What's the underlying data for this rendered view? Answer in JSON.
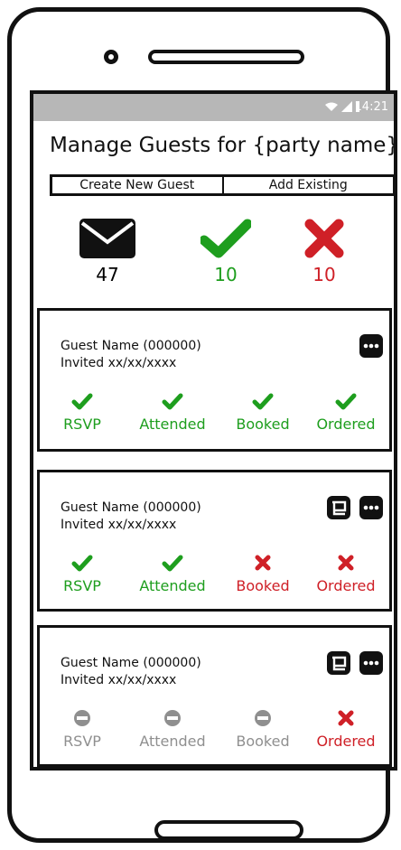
{
  "status_bar": {
    "time": "14:21"
  },
  "header": {
    "title": "Manage Guests for {party name}",
    "create_label": "Create New Guest",
    "existing_label": "Add Existing"
  },
  "summary": {
    "invited": {
      "icon": "envelope-icon",
      "count": "47"
    },
    "accepted": {
      "icon": "check-icon",
      "count": "10",
      "color": "#1e9e1e"
    },
    "declined": {
      "icon": "x-icon",
      "count": "10",
      "color": "#cf2027"
    }
  },
  "guests": [
    {
      "name": "Guest Name (000000)",
      "invited": "Invited xx/xx/xxxx",
      "statuses": [
        {
          "label": "RSVP",
          "state": "yes"
        },
        {
          "label": "Attended",
          "state": "yes"
        },
        {
          "label": "Booked",
          "state": "yes"
        },
        {
          "label": "Ordered",
          "state": "yes"
        }
      ]
    },
    {
      "name": "Guest Name (000000)",
      "invited": "Invited xx/xx/xxxx",
      "statuses": [
        {
          "label": "RSVP",
          "state": "yes"
        },
        {
          "label": "Attended",
          "state": "yes"
        },
        {
          "label": "Booked",
          "state": "no"
        },
        {
          "label": "Ordered",
          "state": "no"
        }
      ]
    },
    {
      "name": "Guest Name (000000)",
      "invited": "Invited xx/xx/xxxx",
      "statuses": [
        {
          "label": "RSVP",
          "state": "na"
        },
        {
          "label": "Attended",
          "state": "na"
        },
        {
          "label": "Booked",
          "state": "na"
        },
        {
          "label": "Ordered",
          "state": "no"
        }
      ]
    }
  ],
  "colors": {
    "yes": "#1e9e1e",
    "no": "#cf2027",
    "na": "#8f8f8f"
  }
}
